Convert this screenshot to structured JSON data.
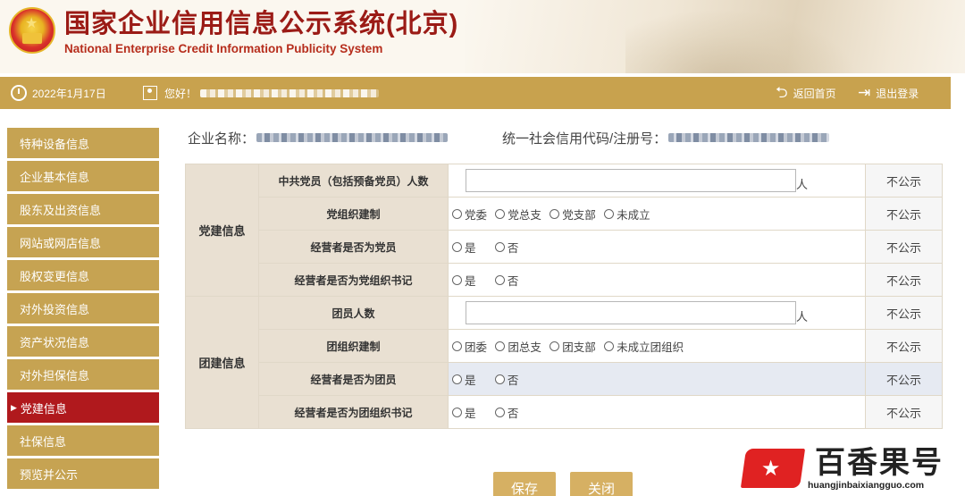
{
  "header": {
    "title_cn": "国家企业信用信息公示系统(北京)",
    "title_en": "National Enterprise Credit Information Publicity System"
  },
  "infobar": {
    "date": "2022年1月17日",
    "greeting": "您好！",
    "home_label": "返回首页",
    "logout_label": "退出登录"
  },
  "sidebar": {
    "items": [
      {
        "label": "特种设备信息"
      },
      {
        "label": "企业基本信息"
      },
      {
        "label": "股东及出资信息"
      },
      {
        "label": "网站或网店信息"
      },
      {
        "label": "股权变更信息"
      },
      {
        "label": "对外投资信息"
      },
      {
        "label": "资产状况信息"
      },
      {
        "label": "对外担保信息"
      },
      {
        "label": "党建信息"
      },
      {
        "label": "社保信息"
      },
      {
        "label": "预览并公示"
      }
    ],
    "active": "党建信息"
  },
  "company": {
    "name_label": "企业名称：",
    "code_label": "统一社会信用代码/注册号："
  },
  "form": {
    "groups": [
      {
        "title": "党建信息",
        "rows": [
          {
            "label": "中共党员（包括预备党员）人数",
            "type": "input",
            "value": "",
            "unit": "人",
            "publicity": "不公示"
          },
          {
            "label": "党组织建制",
            "type": "radio",
            "options": [
              "党委",
              "党总支",
              "党支部",
              "未成立"
            ],
            "publicity": "不公示"
          },
          {
            "label": "经营者是否为党员",
            "type": "radio",
            "options": [
              "是",
              "否"
            ],
            "publicity": "不公示"
          },
          {
            "label": "经营者是否为党组织书记",
            "type": "radio",
            "options": [
              "是",
              "否"
            ],
            "publicity": "不公示"
          }
        ]
      },
      {
        "title": "团建信息",
        "rows": [
          {
            "label": "团员人数",
            "type": "input",
            "value": "",
            "unit": "人",
            "publicity": "不公示"
          },
          {
            "label": "团组织建制",
            "type": "radio",
            "options": [
              "团委",
              "团总支",
              "团支部",
              "未成立团组织"
            ],
            "publicity": "不公示"
          },
          {
            "label": "经营者是否为团员",
            "type": "radio",
            "options": [
              "是",
              "否"
            ],
            "publicity": "不公示"
          },
          {
            "label": "经营者是否为团组织书记",
            "type": "radio",
            "options": [
              "是",
              "否"
            ],
            "publicity": "不公示"
          }
        ]
      }
    ]
  },
  "buttons": {
    "save": "保存",
    "close": "关闭"
  },
  "watermark": {
    "brand_cn": "百香果号",
    "url": "huangjinbaixiangguo.com"
  }
}
